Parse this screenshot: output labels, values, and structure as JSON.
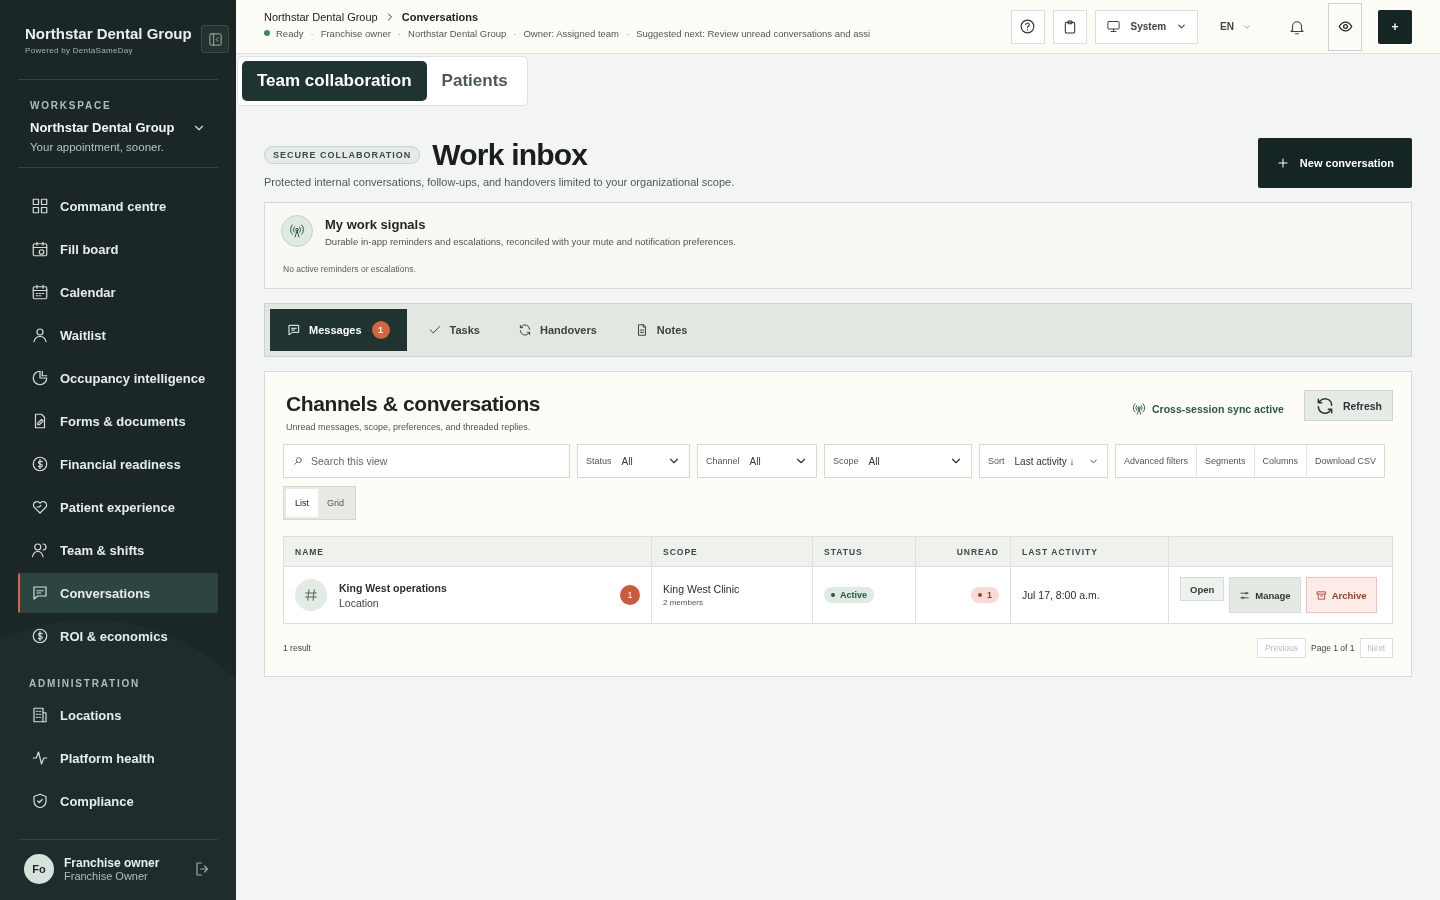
{
  "sidebar": {
    "brand": "Northstar Dental Group",
    "powered_by": "Powered by DentaSameDay",
    "workspace_label": "WORKSPACE",
    "workspace_name": "Northstar Dental Group",
    "tagline": "Your appointment, sooner.",
    "nav": [
      {
        "label": "Command centre",
        "selected": false
      },
      {
        "label": "Fill board",
        "selected": false
      },
      {
        "label": "Calendar",
        "selected": false
      },
      {
        "label": "Waitlist",
        "selected": false
      },
      {
        "label": "Occupancy intelligence",
        "selected": false
      },
      {
        "label": "Forms & documents",
        "selected": false
      },
      {
        "label": "Financial readiness",
        "selected": false
      },
      {
        "label": "Patient experience",
        "selected": false
      },
      {
        "label": "Team & shifts",
        "selected": false
      },
      {
        "label": "Conversations",
        "selected": true
      },
      {
        "label": "ROI & economics",
        "selected": false
      }
    ],
    "admin_label": "ADMINISTRATION",
    "admin_nav": [
      {
        "label": "Locations",
        "selected": false
      },
      {
        "label": "Platform health",
        "selected": false
      },
      {
        "label": "Compliance",
        "selected": false
      }
    ],
    "user": {
      "initials": "Fo",
      "name": "Franchise owner",
      "role": "Franchise Owner"
    }
  },
  "topbar": {
    "breadcrumb": [
      "Northstar Dental Group",
      "Conversations"
    ],
    "status": [
      "Ready",
      "Franchise owner",
      "Northstar Dental Group",
      "Owner: Assigned team",
      "Suggested next: Review unread conversations and assi"
    ],
    "status_separator": "·",
    "theme": "System",
    "language": "EN",
    "plus": "+"
  },
  "mode_tabs": [
    {
      "label": "Team collaboration",
      "selected": true
    },
    {
      "label": "Patients",
      "selected": false
    }
  ],
  "header": {
    "badge": "SECURE COLLABORATION",
    "title": "Work inbox",
    "subtitle": "Protected internal conversations, follow-ups, and handovers limited to your organizational scope.",
    "action": "New conversation"
  },
  "signals": {
    "title": "My work signals",
    "description": "Durable in-app reminders and escalations, reconciled with your mute and notification preferences.",
    "empty": "No active reminders or escalations."
  },
  "tabs": [
    {
      "label": "Messages",
      "selected": true,
      "count": "1"
    },
    {
      "label": "Tasks",
      "selected": false
    },
    {
      "label": "Handovers",
      "selected": false
    },
    {
      "label": "Notes",
      "selected": false
    }
  ],
  "panel": {
    "title": "Channels & conversations",
    "subtitle": "Unread messages, scope, preferences, and threaded replies.",
    "sync": "Cross-session sync active",
    "refresh": "Refresh",
    "search": {
      "placeholder": "Search this view"
    },
    "filters": [
      {
        "label": "Status",
        "value": "All"
      },
      {
        "label": "Channel",
        "value": "All"
      },
      {
        "label": "Scope",
        "value": "All"
      },
      {
        "label": "Sort",
        "value": "Last activity ↓"
      }
    ],
    "tools": [
      "Advanced filters",
      "Segments",
      "Columns",
      "Download CSV"
    ],
    "views": [
      {
        "label": "List",
        "selected": true
      },
      {
        "label": "Grid",
        "selected": false
      }
    ],
    "table": {
      "columns": [
        "NAME",
        "SCOPE",
        "STATUS",
        "UNREAD",
        "LAST ACTIVITY"
      ],
      "rows": [
        {
          "name": "King West operations",
          "type": "Location",
          "badge": "1",
          "scope": "King West Clinic",
          "members": "2 members",
          "status": "Active",
          "unread": "1",
          "last_activity": "Jul 17, 8:00 a.m.",
          "actions": [
            "Open",
            "Manage",
            "Archive"
          ]
        }
      ]
    },
    "result_count": "1 result",
    "pagination": {
      "previous": "Previous",
      "previous_disabled": true,
      "page": "Page 1 of 1",
      "next": "Next",
      "next_disabled": true
    }
  }
}
